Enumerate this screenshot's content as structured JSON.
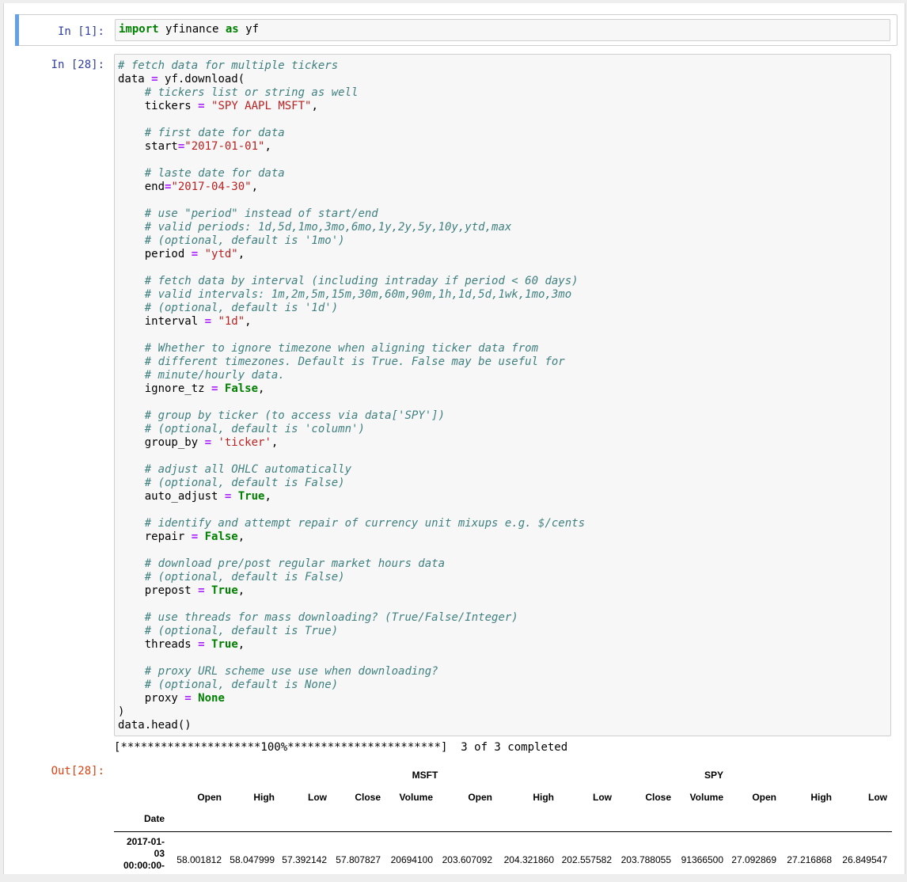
{
  "cell1": {
    "prompt": "In [1]:",
    "code_tokens": [
      {
        "t": "import",
        "c": "kw"
      },
      {
        "t": " yfinance ",
        "c": ""
      },
      {
        "t": "as",
        "c": "kw"
      },
      {
        "t": " yf",
        "c": ""
      }
    ]
  },
  "cell2": {
    "prompt": "In [28]:",
    "lines": [
      [
        {
          "t": "# fetch data for multiple tickers",
          "c": "cm"
        }
      ],
      [
        {
          "t": "data ",
          "c": ""
        },
        {
          "t": "=",
          "c": "op"
        },
        {
          "t": " yf.download(",
          "c": ""
        }
      ],
      [
        {
          "t": "    ",
          "c": ""
        },
        {
          "t": "# tickers list or string as well",
          "c": "cm"
        }
      ],
      [
        {
          "t": "    tickers ",
          "c": ""
        },
        {
          "t": "=",
          "c": "op"
        },
        {
          "t": " ",
          "c": ""
        },
        {
          "t": "\"SPY AAPL MSFT\"",
          "c": "str"
        },
        {
          "t": ",",
          "c": ""
        }
      ],
      [
        {
          "t": "",
          "c": ""
        }
      ],
      [
        {
          "t": "    ",
          "c": ""
        },
        {
          "t": "# first date for data",
          "c": "cm"
        }
      ],
      [
        {
          "t": "    start",
          "c": ""
        },
        {
          "t": "=",
          "c": "op"
        },
        {
          "t": "\"2017-01-01\"",
          "c": "str"
        },
        {
          "t": ",",
          "c": ""
        }
      ],
      [
        {
          "t": "",
          "c": ""
        }
      ],
      [
        {
          "t": "    ",
          "c": ""
        },
        {
          "t": "# laste date for data",
          "c": "cm"
        }
      ],
      [
        {
          "t": "    end",
          "c": ""
        },
        {
          "t": "=",
          "c": "op"
        },
        {
          "t": "\"2017-04-30\"",
          "c": "str"
        },
        {
          "t": ",",
          "c": ""
        }
      ],
      [
        {
          "t": "",
          "c": ""
        }
      ],
      [
        {
          "t": "    ",
          "c": ""
        },
        {
          "t": "# use \"period\" instead of start/end",
          "c": "cm"
        }
      ],
      [
        {
          "t": "    ",
          "c": ""
        },
        {
          "t": "# valid periods: 1d,5d,1mo,3mo,6mo,1y,2y,5y,10y,ytd,max",
          "c": "cm"
        }
      ],
      [
        {
          "t": "    ",
          "c": ""
        },
        {
          "t": "# (optional, default is '1mo')",
          "c": "cm"
        }
      ],
      [
        {
          "t": "    period ",
          "c": ""
        },
        {
          "t": "=",
          "c": "op"
        },
        {
          "t": " ",
          "c": ""
        },
        {
          "t": "\"ytd\"",
          "c": "str"
        },
        {
          "t": ",",
          "c": ""
        }
      ],
      [
        {
          "t": "",
          "c": ""
        }
      ],
      [
        {
          "t": "    ",
          "c": ""
        },
        {
          "t": "# fetch data by interval (including intraday if period < 60 days)",
          "c": "cm"
        }
      ],
      [
        {
          "t": "    ",
          "c": ""
        },
        {
          "t": "# valid intervals: 1m,2m,5m,15m,30m,60m,90m,1h,1d,5d,1wk,1mo,3mo",
          "c": "cm"
        }
      ],
      [
        {
          "t": "    ",
          "c": ""
        },
        {
          "t": "# (optional, default is '1d')",
          "c": "cm"
        }
      ],
      [
        {
          "t": "    interval ",
          "c": ""
        },
        {
          "t": "=",
          "c": "op"
        },
        {
          "t": " ",
          "c": ""
        },
        {
          "t": "\"1d\"",
          "c": "str"
        },
        {
          "t": ",",
          "c": ""
        }
      ],
      [
        {
          "t": "",
          "c": ""
        }
      ],
      [
        {
          "t": "    ",
          "c": ""
        },
        {
          "t": "# Whether to ignore timezone when aligning ticker data from",
          "c": "cm"
        }
      ],
      [
        {
          "t": "    ",
          "c": ""
        },
        {
          "t": "# different timezones. Default is True. False may be useful for",
          "c": "cm"
        }
      ],
      [
        {
          "t": "    ",
          "c": ""
        },
        {
          "t": "# minute/hourly data.",
          "c": "cm"
        }
      ],
      [
        {
          "t": "    ignore_tz ",
          "c": ""
        },
        {
          "t": "=",
          "c": "op"
        },
        {
          "t": " ",
          "c": ""
        },
        {
          "t": "False",
          "c": "kw"
        },
        {
          "t": ",",
          "c": ""
        }
      ],
      [
        {
          "t": "",
          "c": ""
        }
      ],
      [
        {
          "t": "    ",
          "c": ""
        },
        {
          "t": "# group by ticker (to access via data['SPY'])",
          "c": "cm"
        }
      ],
      [
        {
          "t": "    ",
          "c": ""
        },
        {
          "t": "# (optional, default is 'column')",
          "c": "cm"
        }
      ],
      [
        {
          "t": "    group_by ",
          "c": ""
        },
        {
          "t": "=",
          "c": "op"
        },
        {
          "t": " ",
          "c": ""
        },
        {
          "t": "'ticker'",
          "c": "str"
        },
        {
          "t": ",",
          "c": ""
        }
      ],
      [
        {
          "t": "",
          "c": ""
        }
      ],
      [
        {
          "t": "    ",
          "c": ""
        },
        {
          "t": "# adjust all OHLC automatically",
          "c": "cm"
        }
      ],
      [
        {
          "t": "    ",
          "c": ""
        },
        {
          "t": "# (optional, default is False)",
          "c": "cm"
        }
      ],
      [
        {
          "t": "    auto_adjust ",
          "c": ""
        },
        {
          "t": "=",
          "c": "op"
        },
        {
          "t": " ",
          "c": ""
        },
        {
          "t": "True",
          "c": "kw"
        },
        {
          "t": ",",
          "c": ""
        }
      ],
      [
        {
          "t": "",
          "c": ""
        }
      ],
      [
        {
          "t": "    ",
          "c": ""
        },
        {
          "t": "# identify and attempt repair of currency unit mixups e.g. $/cents",
          "c": "cm"
        }
      ],
      [
        {
          "t": "    repair ",
          "c": ""
        },
        {
          "t": "=",
          "c": "op"
        },
        {
          "t": " ",
          "c": ""
        },
        {
          "t": "False",
          "c": "kw"
        },
        {
          "t": ",",
          "c": ""
        }
      ],
      [
        {
          "t": "",
          "c": ""
        }
      ],
      [
        {
          "t": "    ",
          "c": ""
        },
        {
          "t": "# download pre/post regular market hours data",
          "c": "cm"
        }
      ],
      [
        {
          "t": "    ",
          "c": ""
        },
        {
          "t": "# (optional, default is False)",
          "c": "cm"
        }
      ],
      [
        {
          "t": "    prepost ",
          "c": ""
        },
        {
          "t": "=",
          "c": "op"
        },
        {
          "t": " ",
          "c": ""
        },
        {
          "t": "True",
          "c": "kw"
        },
        {
          "t": ",",
          "c": ""
        }
      ],
      [
        {
          "t": "",
          "c": ""
        }
      ],
      [
        {
          "t": "    ",
          "c": ""
        },
        {
          "t": "# use threads for mass downloading? (True/False/Integer)",
          "c": "cm"
        }
      ],
      [
        {
          "t": "    ",
          "c": ""
        },
        {
          "t": "# (optional, default is True)",
          "c": "cm"
        }
      ],
      [
        {
          "t": "    threads ",
          "c": ""
        },
        {
          "t": "=",
          "c": "op"
        },
        {
          "t": " ",
          "c": ""
        },
        {
          "t": "True",
          "c": "kw"
        },
        {
          "t": ",",
          "c": ""
        }
      ],
      [
        {
          "t": "",
          "c": ""
        }
      ],
      [
        {
          "t": "    ",
          "c": ""
        },
        {
          "t": "# proxy URL scheme use use when downloading?",
          "c": "cm"
        }
      ],
      [
        {
          "t": "    ",
          "c": ""
        },
        {
          "t": "# (optional, default is None)",
          "c": "cm"
        }
      ],
      [
        {
          "t": "    proxy ",
          "c": ""
        },
        {
          "t": "=",
          "c": "op"
        },
        {
          "t": " ",
          "c": ""
        },
        {
          "t": "None",
          "c": "kw"
        }
      ],
      [
        {
          "t": ")",
          "c": ""
        }
      ],
      [
        {
          "t": "data.head()",
          "c": ""
        }
      ]
    ]
  },
  "progress_text": "[*********************100%***********************]  3 of 3 completed",
  "output": {
    "prompt": "Out[28]:",
    "ticker_headers": [
      "MSFT",
      "SPY"
    ],
    "column_headers": [
      "Open",
      "High",
      "Low",
      "Close",
      "Volume",
      "Open",
      "High",
      "Low",
      "Close",
      "Volume",
      "Open",
      "High",
      "Low"
    ],
    "index_name": "Date",
    "rows": [
      {
        "date_lines": [
          "2017-01-",
          "03",
          "00:00:00-"
        ],
        "values": [
          "58.001812",
          "58.047999",
          "57.392142",
          "57.807827",
          "20694100",
          "203.607092",
          "204.321860",
          "202.557582",
          "203.788055",
          "91366500",
          "27.092869",
          "27.216868",
          "26.849547"
        ]
      }
    ]
  },
  "colors": {
    "selected_bar": "#66a0e6",
    "in_prompt": "#303f9f",
    "out_prompt": "#d84315",
    "keyword": "#008000",
    "operator": "#aa22ff",
    "string": "#ba2121",
    "comment": "#408080"
  }
}
